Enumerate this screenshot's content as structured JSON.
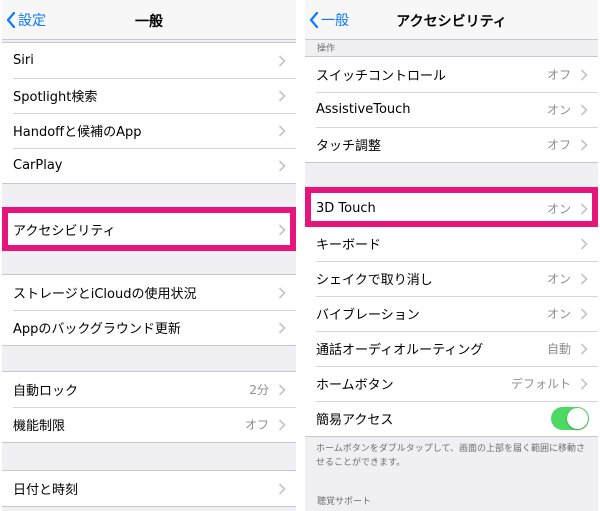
{
  "left": {
    "nav": {
      "back_label": "設定",
      "title": "一般"
    },
    "groups": [
      [
        "Siri",
        "Spotlight検索",
        "Handoffと候補のApp",
        "CarPlay"
      ],
      [
        "アクセシビリティ"
      ],
      [
        "ストレージとiCloudの使用状況",
        "Appのバックグラウンド更新"
      ],
      [
        {
          "label": "自動ロック",
          "value": "2分"
        },
        {
          "label": "機能制限",
          "value": "オフ"
        }
      ],
      [
        "日付と時刻"
      ]
    ]
  },
  "right": {
    "nav": {
      "back_label": "一般",
      "title": "アクセシビリティ"
    },
    "section_operation": "操作",
    "group1": [
      {
        "label": "スイッチコントロール",
        "value": "オフ"
      },
      {
        "label": "AssistiveTouch",
        "value": "オン"
      },
      {
        "label": "タッチ調整",
        "value": "オフ"
      }
    ],
    "group2": [
      {
        "label": "3D Touch",
        "value": "オン"
      },
      {
        "label": "キーボード",
        "value": ""
      },
      {
        "label": "シェイクで取り消し",
        "value": "オン"
      },
      {
        "label": "バイブレーション",
        "value": "オン"
      },
      {
        "label": "通話オーディオルーティング",
        "value": "自動"
      },
      {
        "label": "ホームボタン",
        "value": "デフォルト"
      },
      {
        "label": "簡易アクセス",
        "value": "",
        "toggle": true
      }
    ],
    "footer_note": "ホームボタンをダブルタップして、画面の上部を届く範囲に移動させることができます。",
    "section_hearing": "聴覚サポート"
  },
  "colors": {
    "ios_blue": "#0a7aff",
    "highlight": "#e5157b",
    "toggle_on": "#4cd964"
  }
}
